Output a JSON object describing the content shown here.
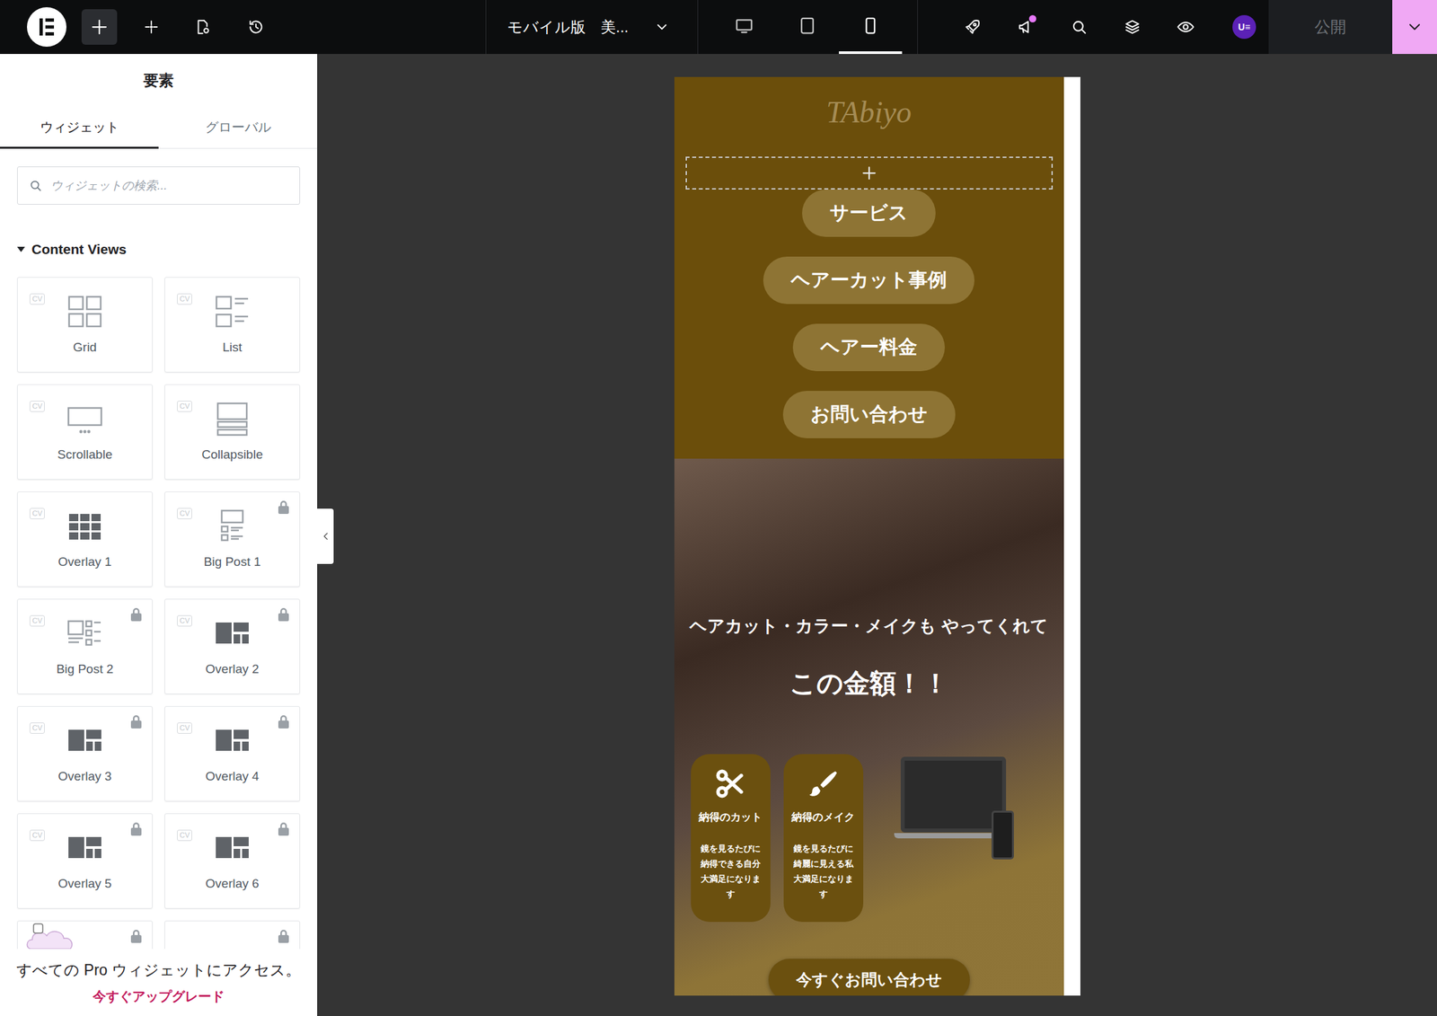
{
  "topbar": {
    "title": "モバイル版　美...",
    "devices": [
      {
        "kind": "desktop",
        "selected": false
      },
      {
        "kind": "tablet",
        "selected": false
      },
      {
        "kind": "mobile",
        "selected": true
      }
    ],
    "avatar": "U≡",
    "publish": "公開"
  },
  "panel": {
    "title": "要素",
    "tabs": [
      {
        "label": "ウィジェット",
        "selected": true
      },
      {
        "label": "グローバル",
        "selected": false
      }
    ],
    "search": {
      "placeholder": "ウィジェットの検索..."
    },
    "section": {
      "label": "Content Views",
      "expanded": true
    },
    "widgets": [
      {
        "label": "Grid",
        "badge": "CV",
        "kind": "grid",
        "locked": false
      },
      {
        "label": "List",
        "badge": "CV",
        "kind": "list",
        "locked": false
      },
      {
        "label": "Scrollable",
        "badge": "CV",
        "kind": "scrollable",
        "locked": false
      },
      {
        "label": "Collapsible",
        "badge": "CV",
        "kind": "collapsible",
        "locked": false
      },
      {
        "label": "Overlay 1",
        "badge": "CV",
        "kind": "tiles",
        "locked": false
      },
      {
        "label": "Big Post 1",
        "badge": "CV",
        "kind": "bigpost",
        "locked": true
      },
      {
        "label": "Big Post 2",
        "badge": "CV",
        "kind": "bigpost2",
        "locked": true
      },
      {
        "label": "Overlay 2",
        "badge": "CV",
        "kind": "blocks",
        "locked": true
      },
      {
        "label": "Overlay 3",
        "badge": "CV",
        "kind": "blocks",
        "locked": true
      },
      {
        "label": "Overlay 4",
        "badge": "CV",
        "kind": "blocks",
        "locked": true
      },
      {
        "label": "Overlay 5",
        "badge": "CV",
        "kind": "blocks",
        "locked": true
      },
      {
        "label": "Overlay 6",
        "badge": "CV",
        "kind": "blocks",
        "locked": true
      }
    ],
    "promo": {
      "text": "すべての Pro ウィジェットにアクセス。",
      "link": "今すぐアップグレード"
    }
  },
  "preview": {
    "logo": "TAbiyo",
    "menu": [
      "サービス",
      "ヘアーカット事例",
      "ヘアー料金",
      "お問い合わせ"
    ],
    "hero": {
      "line1": "ヘアカット・カラー・メイクも やってくれて",
      "line2": "この金額！！"
    },
    "features": [
      {
        "kind": "scissors",
        "title": "納得のカット",
        "text": "鏡を見るたびに納得できる自分大満足になります"
      },
      {
        "kind": "brush",
        "title": "納得のメイク",
        "text": "鏡を見るたびに綺麗に見える私大満足になります"
      }
    ],
    "cta": "今すぐお問い合わせ"
  }
}
